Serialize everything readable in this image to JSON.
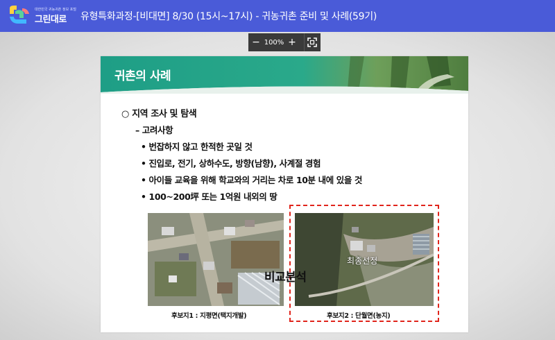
{
  "header": {
    "logo_tagline": "대한민국 귀농귀촌 정보 포털",
    "logo_text": "그린대로",
    "title": "유형특화과정-[비대면] 8/30 (15시~17시) - 귀농귀촌 준비 및 사례(59기)"
  },
  "zoom": {
    "minus_label": "−",
    "value": "100%",
    "plus_label": "+",
    "fullscreen_icon": "fullscreen-icon"
  },
  "slide": {
    "title": "귀촌의 사례",
    "lines": [
      "○ 지역 조사 및 탐색",
      "– 고려사항",
      "• 번잡하지 않고 한적한 곳일 것",
      "• 진입로, 전기, 상하수도, 방향(남향), 사계절 경험",
      "• 아이들 교육을 위해 학교와의 거리는 차로 10분 내에 있을 것",
      "• 100~200坪 또는 1억원 내외의 땅"
    ],
    "compare_label": "비교분석",
    "selected_label": "최종선정",
    "caption1": "후보지1 : 지평면(택지개발)",
    "caption2": "후보지2 : 단월면(농지)"
  },
  "colors": {
    "topbar": "#4a5bd8",
    "banner_teal": "#1e9e86",
    "dash_red": "#e0241b"
  }
}
